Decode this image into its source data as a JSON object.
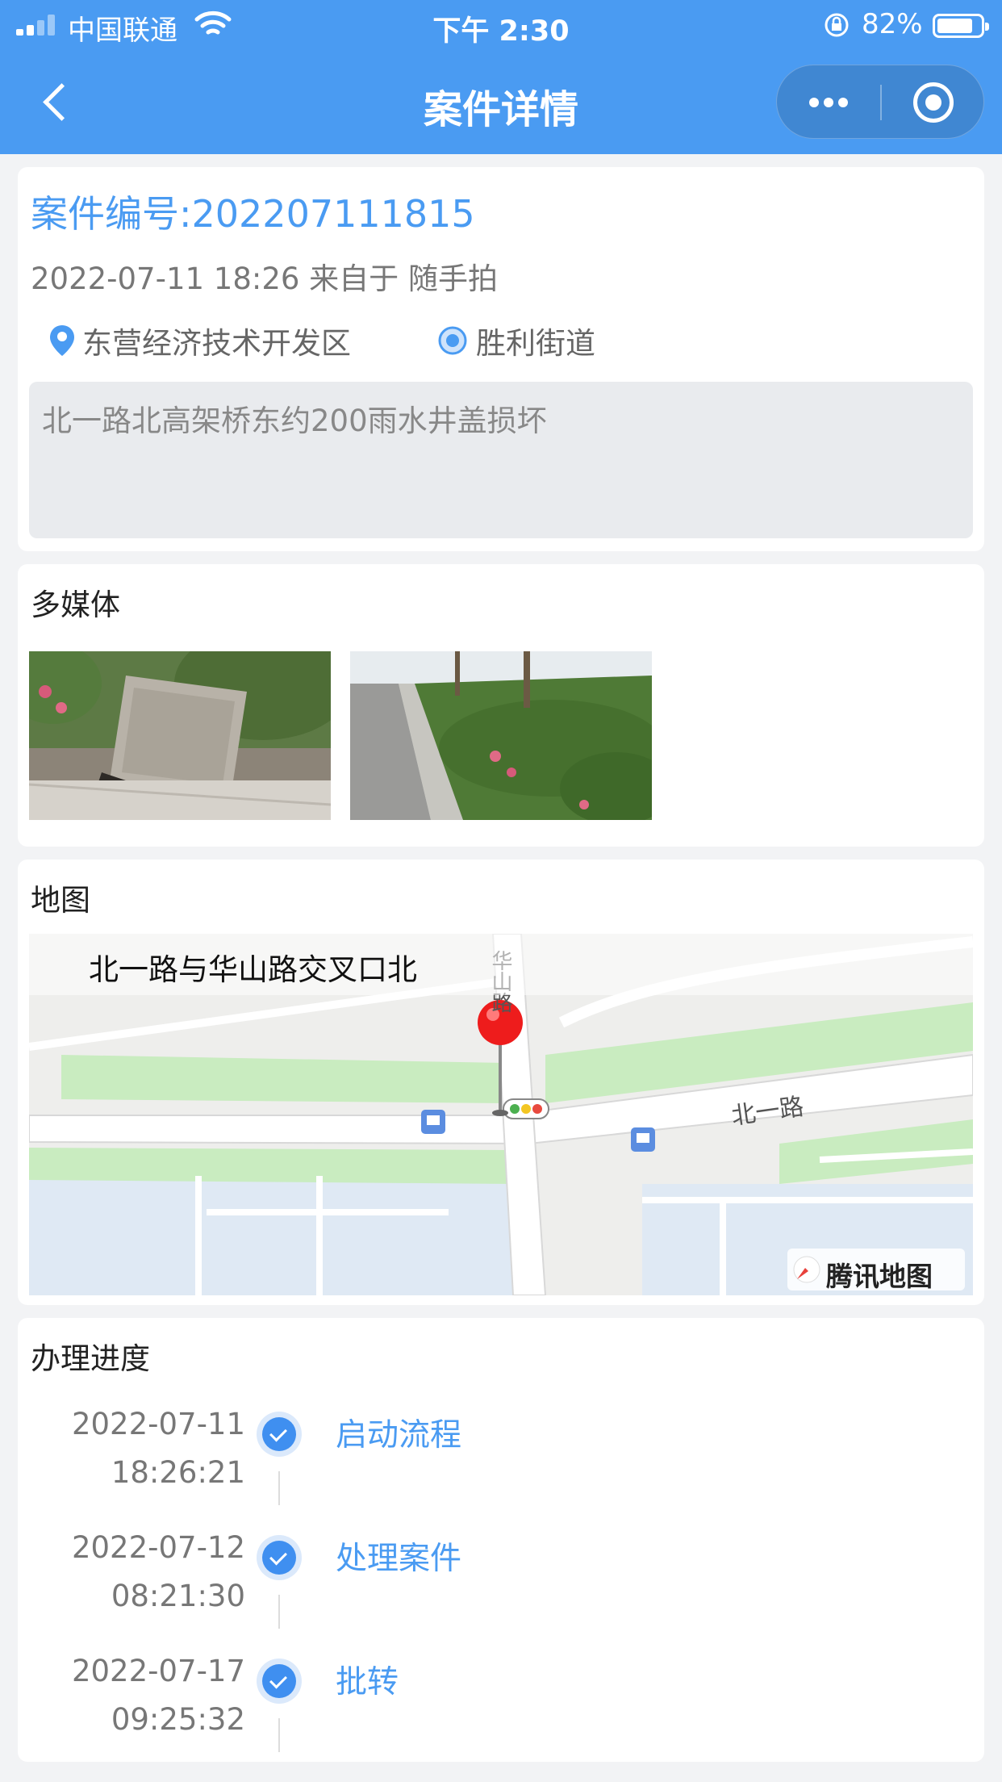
{
  "status_bar": {
    "carrier": "中国联通",
    "time": "下午 2:30",
    "battery_percent": "82%",
    "battery_level": 0.82,
    "icons": [
      "signal-icon",
      "wifi-icon",
      "rotation-lock-icon",
      "battery-icon"
    ]
  },
  "nav": {
    "title": "案件详情",
    "back_icon": "chevron-left-icon",
    "more_icon": "more-dots-icon",
    "close_icon": "target-circle-icon"
  },
  "case": {
    "number_label": "案件编号:202207111815",
    "meta": "2022-07-11 18:26 来自于 随手拍",
    "region": "东营经济技术开发区",
    "street": "胜利街道",
    "description": "北一路北高架桥东约200雨水井盖损坏"
  },
  "media": {
    "title": "多媒体",
    "items": [
      {
        "alt": "damaged manhole cover photo"
      },
      {
        "alt": "roadside greenbelt photo"
      }
    ]
  },
  "map": {
    "title": "地图",
    "location_label": "北一路与华山路交叉口北",
    "road_labels": [
      "北一路",
      "华山路"
    ],
    "provider": "腾讯地图"
  },
  "progress": {
    "title": "办理进度",
    "steps": [
      {
        "date": "2022-07-11",
        "time": "18:26:21",
        "name": "启动流程"
      },
      {
        "date": "2022-07-12",
        "time": "08:21:30",
        "name": "处理案件"
      },
      {
        "date": "2022-07-17",
        "time": "09:25:32",
        "name": "批转"
      }
    ]
  },
  "colors": {
    "primary": "#4a9bf2",
    "page_bg": "#f2f3f5",
    "card_bg": "#ffffff",
    "desc_bg": "#e9ebee",
    "check_blue": "#3f8ff0"
  }
}
